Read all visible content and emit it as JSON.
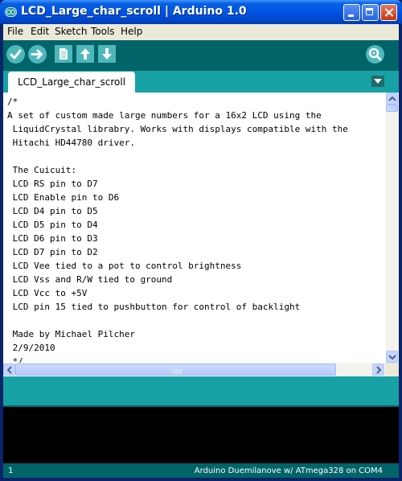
{
  "window": {
    "title": "LCD_Large_char_scroll | Arduino 1.0"
  },
  "menu": {
    "items": [
      "File",
      "Edit",
      "Sketch",
      "Tools",
      "Help"
    ]
  },
  "toolbar": {
    "buttons": [
      "verify-icon",
      "upload-icon",
      "new-icon",
      "open-icon",
      "save-icon",
      "serial-monitor-icon"
    ]
  },
  "tabs": {
    "active_label": "LCD_Large_char_scroll"
  },
  "editor": {
    "lines": [
      "/*",
      "A set of custom made large numbers for a 16x2 LCD using the",
      " LiquidCrystal librabry. Works with displays compatible with the",
      " Hitachi HD44780 driver.",
      "",
      " The Cuicuit:",
      " LCD RS pin to D7",
      " LCD Enable pin to D6",
      " LCD D4 pin to D5",
      " LCD D5 pin to D4",
      " LCD D6 pin to D3",
      " LCD D7 pin to D2",
      " LCD Vee tied to a pot to control brightness",
      " LCD Vss and R/W tied to ground",
      " LCD Vcc to +5V",
      " LCD pin 15 tied to pushbutton for control of backlight",
      "",
      " Made by Michael Pilcher",
      " 2/9/2010",
      " */"
    ]
  },
  "status": {
    "line_number": "1",
    "board": "Arduino Duemilanove w/ ATmega328 on COM4"
  },
  "colors": {
    "toolbar_bg": "#006468",
    "tabbar_bg": "#17a1a5",
    "button_bg": "#4db7bb"
  }
}
